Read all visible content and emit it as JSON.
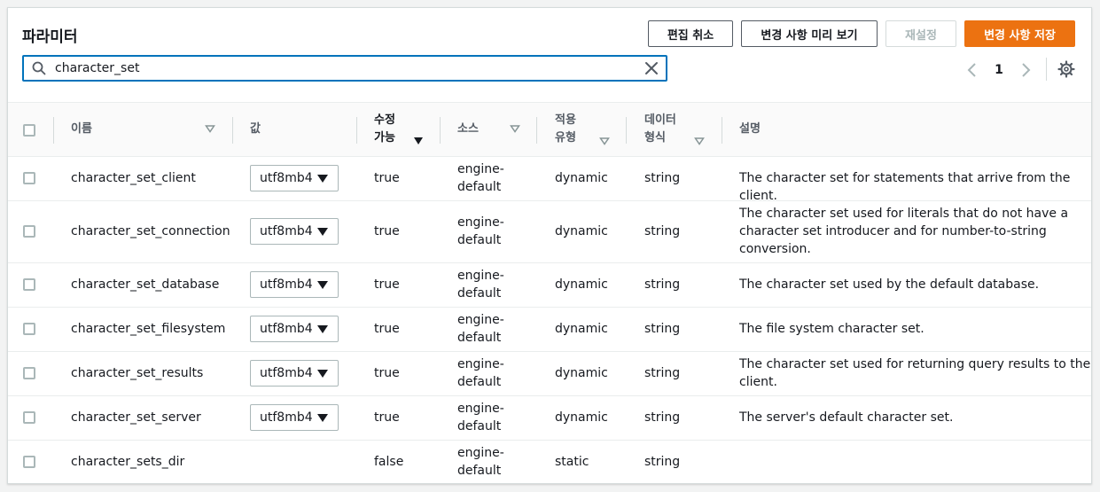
{
  "header": {
    "title": "파라미터",
    "buttons": {
      "cancel_edit": "편집 취소",
      "preview_changes": "변경 사항 미리 보기",
      "reset": "재설정",
      "save_changes": "변경 사항 저장"
    }
  },
  "search": {
    "value": "character_set",
    "placeholder": ""
  },
  "pagination": {
    "current_page": "1"
  },
  "table": {
    "columns": {
      "name": "이름",
      "value": "값",
      "modifiable_line1": "수정",
      "modifiable_line2": "가능",
      "source": "소스",
      "apply_type_line1": "적용",
      "apply_type_line2": "유형",
      "data_type_line1": "데이터",
      "data_type_line2": "형식",
      "description": "설명"
    },
    "rows": [
      {
        "name": "character_set_client",
        "value": "utf8mb4",
        "modifiable": "true",
        "source_line1": "engine-",
        "source_line2": "default",
        "apply_type": "dynamic",
        "data_type": "string",
        "description_lines": [
          "The character set for statements that arrive from the client."
        ]
      },
      {
        "name": "character_set_connection",
        "value": "utf8mb4",
        "modifiable": "true",
        "source_line1": "engine-",
        "source_line2": "default",
        "apply_type": "dynamic",
        "data_type": "string",
        "description_lines": [
          "The character set used for literals that do not have a",
          "character set introducer and for number-to-string",
          "conversion."
        ]
      },
      {
        "name": "character_set_database",
        "value": "utf8mb4",
        "modifiable": "true",
        "source_line1": "engine-",
        "source_line2": "default",
        "apply_type": "dynamic",
        "data_type": "string",
        "description_lines": [
          "The character set used by the default database."
        ]
      },
      {
        "name": "character_set_filesystem",
        "value": "utf8mb4",
        "modifiable": "true",
        "source_line1": "engine-",
        "source_line2": "default",
        "apply_type": "dynamic",
        "data_type": "string",
        "description_lines": [
          "The file system character set."
        ]
      },
      {
        "name": "character_set_results",
        "value": "utf8mb4",
        "modifiable": "true",
        "source_line1": "engine-",
        "source_line2": "default",
        "apply_type": "dynamic",
        "data_type": "string",
        "description_lines": [
          "The character set used for returning query results to the",
          "client."
        ]
      },
      {
        "name": "character_set_server",
        "value": "utf8mb4",
        "modifiable": "true",
        "source_line1": "engine-",
        "source_line2": "default",
        "apply_type": "dynamic",
        "data_type": "string",
        "description_lines": [
          "The server's default character set."
        ]
      },
      {
        "name": "character_sets_dir",
        "value": "",
        "modifiable": "false",
        "source_line1": "engine-",
        "source_line2": "default",
        "apply_type": "static",
        "data_type": "string",
        "description_lines": []
      }
    ]
  },
  "colors": {
    "primary_button": "#ec7211",
    "search_focus": "#0073bb",
    "disabled_text": "#aab7b8",
    "border": "#d5dbdb"
  },
  "icons": {
    "search": "search-icon",
    "clear": "close-icon",
    "prev": "chevron-left-icon",
    "next": "chevron-right-icon",
    "settings": "gear-icon",
    "sort": "sort-caret-icon",
    "dropdown": "caret-down-icon"
  }
}
